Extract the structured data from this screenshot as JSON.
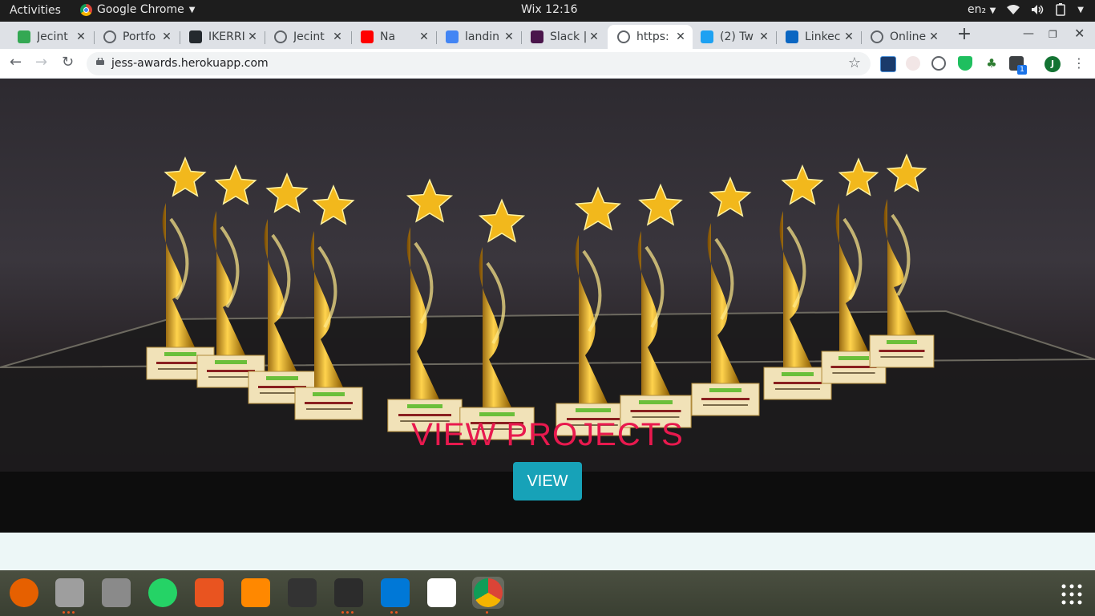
{
  "topbar": {
    "activities": "Activities",
    "app_name": "Google Chrome",
    "clock": "Wix 12:16",
    "lang": "en₂"
  },
  "tabs": [
    {
      "title": "Jecint",
      "icon": "code-icon",
      "color": "#34a853"
    },
    {
      "title": "Portfo",
      "icon": "globe-icon",
      "color": "#5f6368"
    },
    {
      "title": "IKERRI",
      "icon": "github-icon",
      "color": "#24292e"
    },
    {
      "title": "Jecint",
      "icon": "globe-icon",
      "color": "#5f6368"
    },
    {
      "title": "Na",
      "icon": "youtube-icon",
      "color": "#ff0000"
    },
    {
      "title": "landin",
      "icon": "google-icon",
      "color": "#4285f4"
    },
    {
      "title": "Slack |",
      "icon": "slack-icon",
      "color": "#4a154b"
    },
    {
      "title": "https:",
      "icon": "globe-icon",
      "color": "#5f6368"
    },
    {
      "title": "(2) Tw",
      "icon": "twitter-icon",
      "color": "#1da1f2"
    },
    {
      "title": "Linkec",
      "icon": "linkedin-icon",
      "color": "#0a66c2"
    },
    {
      "title": "Online",
      "icon": "globe-icon",
      "color": "#5f6368"
    }
  ],
  "active_tab": 7,
  "address": {
    "url": "jess-awards.herokuapp.com"
  },
  "profile": {
    "initial": "J",
    "color": "#137333"
  },
  "extension_badge": "1",
  "page": {
    "hero_title": "VIEW PROJECTS",
    "view_button": "VIEW",
    "title_color": "#e8194e",
    "button_color": "#17a2b8"
  },
  "dock": [
    {
      "name": "firefox-icon"
    },
    {
      "name": "files-icon"
    },
    {
      "name": "settings-icon"
    },
    {
      "name": "whatsapp-icon"
    },
    {
      "name": "software-center-icon"
    },
    {
      "name": "vlc-icon"
    },
    {
      "name": "video-editor-icon"
    },
    {
      "name": "terminal-icon"
    },
    {
      "name": "vscode-icon"
    },
    {
      "name": "text-editor-icon"
    },
    {
      "name": "chrome-icon"
    }
  ]
}
